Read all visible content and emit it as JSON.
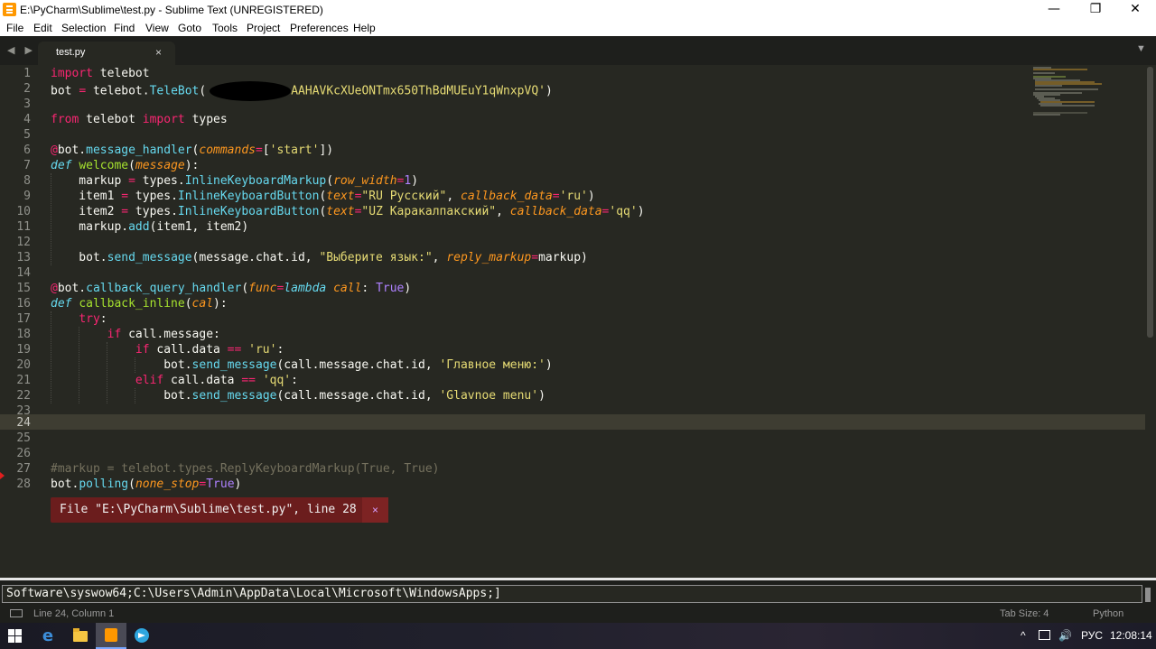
{
  "window": {
    "title": "E:\\PyCharm\\Sublime\\test.py - Sublime Text (UNREGISTERED)",
    "controls": {
      "minimize": "—",
      "maximize": "❐",
      "close": "✕"
    }
  },
  "menu": [
    "File",
    "Edit",
    "Selection",
    "Find",
    "View",
    "Goto",
    "Tools",
    "Project",
    "Preferences",
    "Help"
  ],
  "tabs": {
    "nav": "◀ ▶",
    "active": {
      "label": "test.py",
      "close": "×"
    },
    "dropdown": "▼"
  },
  "editor": {
    "line_numbers": [
      "1",
      "2",
      "3",
      "4",
      "5",
      "6",
      "7",
      "8",
      "9",
      "10",
      "11",
      "12",
      "13",
      "14",
      "15",
      "16",
      "17",
      "18",
      "19",
      "20",
      "21",
      "22",
      "23",
      "24",
      "25",
      "26",
      "27",
      "28"
    ],
    "code": {
      "l2_token_tail": "AAHAVKcXUeONTmx650ThBdMUEuY1qWnxpVQ'",
      "l4_module": "types",
      "l7_func": "welcome",
      "l9_ru": "\"RU Русский\"",
      "l10_uz": "\"UZ Каракалпакский\"",
      "l13_text": "\"Выберите язык:\"",
      "l16_func": "callback_inline",
      "l20_text": "'Главное меню:'",
      "l22_text": "'Glavnoe menu'",
      "l27_comment": "#markup = telebot.types.ReplyKeyboardMarkup(True, True)"
    },
    "error_phantom": {
      "text": "File \"E:\\PyCharm\\Sublime\\test.py\", line 28",
      "close": "×"
    }
  },
  "console": {
    "text": "Software\\syswow64;C:\\Users\\Admin\\AppData\\Local\\Microsoft\\WindowsApps;]"
  },
  "status": {
    "position": "Line 24, Column 1",
    "tab_size": "Tab Size: 4",
    "syntax": "Python"
  },
  "taskbar": {
    "language": "РУС",
    "time": "12:08:14",
    "tray_up": "^",
    "volume": "🔊"
  },
  "colors": {
    "background": "#272822",
    "keyword": "#f92672",
    "function": "#66d9ef",
    "string": "#e6db74",
    "parameter": "#fd971f",
    "constant": "#ae81ff",
    "comment": "#75715e",
    "error_phantom": "#6b1d1d"
  }
}
